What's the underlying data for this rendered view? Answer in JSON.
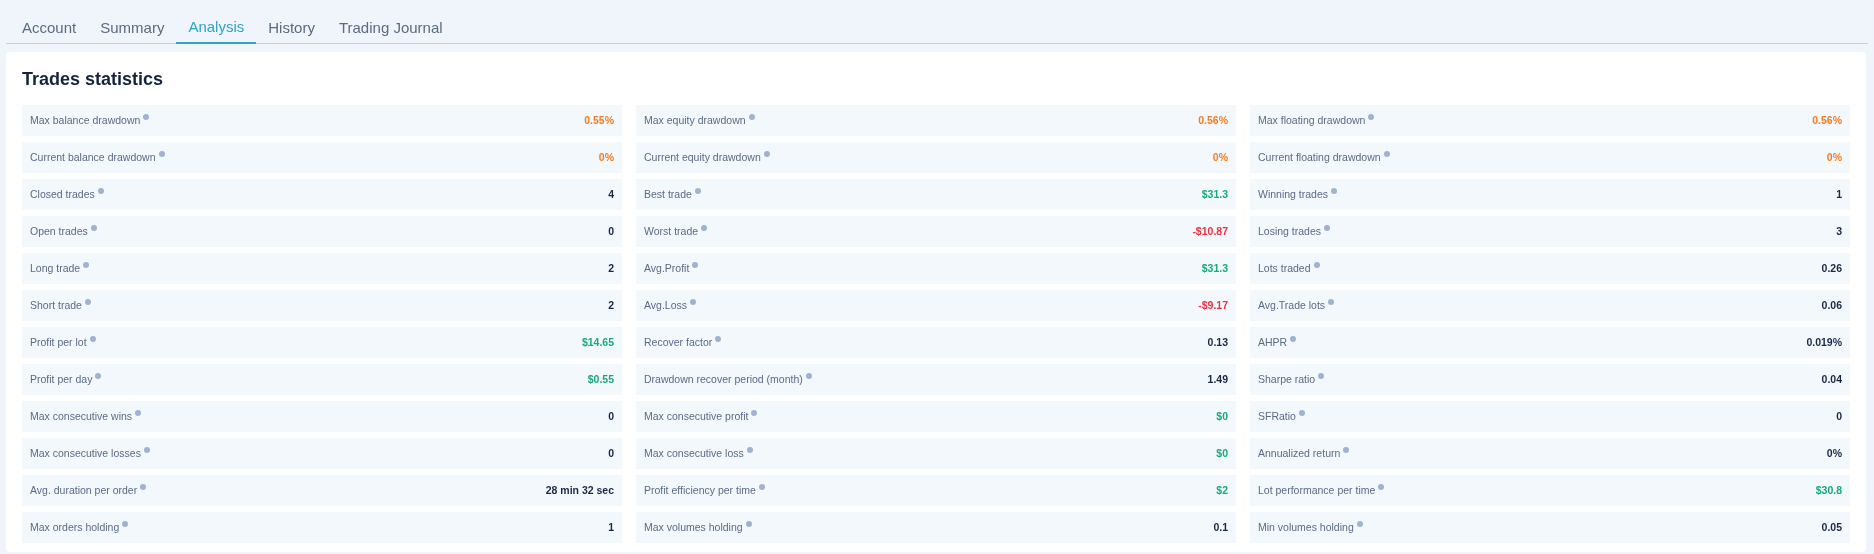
{
  "tabs": [
    {
      "label": "Account",
      "selected": false
    },
    {
      "label": "Summary",
      "selected": false
    },
    {
      "label": "Analysis",
      "selected": true
    },
    {
      "label": "History",
      "selected": false
    },
    {
      "label": "Trading Journal",
      "selected": false
    }
  ],
  "panel": {
    "title": "Trades statistics",
    "stats": [
      {
        "label": "Max balance drawdown",
        "value": "0.55%",
        "kind": "warning"
      },
      {
        "label": "Max equity drawdown",
        "value": "0.56%",
        "kind": "warning"
      },
      {
        "label": "Max floating drawdown",
        "value": "0.56%",
        "kind": "warning"
      },
      {
        "label": "Current balance drawdown",
        "value": "0%",
        "kind": "warning"
      },
      {
        "label": "Current equity drawdown",
        "value": "0%",
        "kind": "warning"
      },
      {
        "label": "Current floating drawdown",
        "value": "0%",
        "kind": "warning"
      },
      {
        "label": "Closed trades",
        "value": "4",
        "kind": "plain"
      },
      {
        "label": "Best trade",
        "value": "$31.3",
        "kind": "positive"
      },
      {
        "label": "Winning trades",
        "value": "1",
        "kind": "plain"
      },
      {
        "label": "Open trades",
        "value": "0",
        "kind": "plain"
      },
      {
        "label": "Worst trade",
        "value": "-$10.87",
        "kind": "negative"
      },
      {
        "label": "Losing trades",
        "value": "3",
        "kind": "plain"
      },
      {
        "label": "Long trade",
        "value": "2",
        "kind": "plain"
      },
      {
        "label": "Avg.Profit",
        "value": "$31.3",
        "kind": "positive"
      },
      {
        "label": "Lots traded",
        "value": "0.26",
        "kind": "plain"
      },
      {
        "label": "Short trade",
        "value": "2",
        "kind": "plain"
      },
      {
        "label": "Avg.Loss",
        "value": "-$9.17",
        "kind": "negative"
      },
      {
        "label": "Avg.Trade lots",
        "value": "0.06",
        "kind": "plain"
      },
      {
        "label": "Profit per lot",
        "value": "$14.65",
        "kind": "positive"
      },
      {
        "label": "Recover factor",
        "value": "0.13",
        "kind": "plain"
      },
      {
        "label": "AHPR",
        "value": "0.019%",
        "kind": "plain"
      },
      {
        "label": "Profit per day",
        "value": "$0.55",
        "kind": "positive"
      },
      {
        "label": "Drawdown recover period (month)",
        "value": "1.49",
        "kind": "plain"
      },
      {
        "label": "Sharpe ratio",
        "value": "0.04",
        "kind": "plain"
      },
      {
        "label": "Max consecutive wins",
        "value": "0",
        "kind": "plain"
      },
      {
        "label": "Max consecutive profit",
        "value": "$0",
        "kind": "positive"
      },
      {
        "label": "SFRatio",
        "value": "0",
        "kind": "plain"
      },
      {
        "label": "Max consecutive losses",
        "value": "0",
        "kind": "plain"
      },
      {
        "label": "Max consecutive loss",
        "value": "$0",
        "kind": "positive"
      },
      {
        "label": "Annualized return",
        "value": "0%",
        "kind": "plain"
      },
      {
        "label": "Avg. duration per order",
        "value": "28 min 32 sec",
        "kind": "plain"
      },
      {
        "label": "Profit efficiency per time",
        "value": "$2",
        "kind": "positive"
      },
      {
        "label": "Lot performance per time",
        "value": "$30.8",
        "kind": "positive"
      },
      {
        "label": "Max orders holding",
        "value": "1",
        "kind": "plain"
      },
      {
        "label": "Max volumes holding",
        "value": "0.1",
        "kind": "plain"
      },
      {
        "label": "Min volumes holding",
        "value": "0.05",
        "kind": "plain"
      }
    ]
  }
}
